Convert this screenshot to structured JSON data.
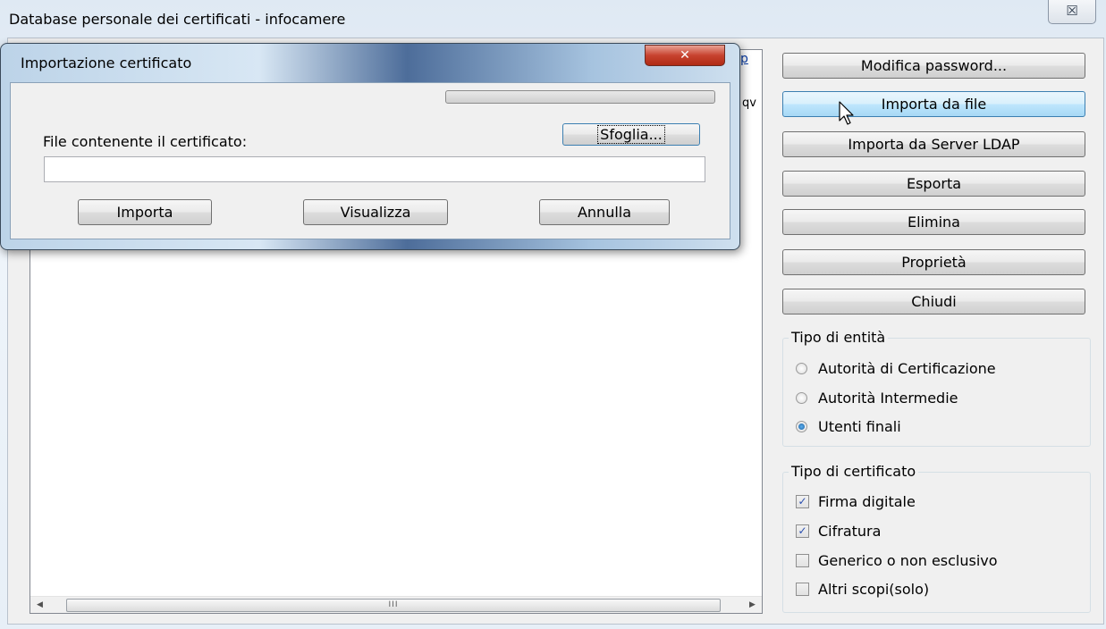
{
  "window": {
    "title": "Database personale dei certificati - infocamere",
    "close_glyph": "☒"
  },
  "dialog": {
    "title": "Importazione certificato",
    "close_glyph": "✕",
    "file_label": "File contenente il certificato:",
    "file_value": "",
    "browse_label": "Sfoglia...",
    "import_label": "Importa",
    "view_label": "Visualizza",
    "cancel_label": "Annulla"
  },
  "background_fragments": {
    "frag1": "p",
    "frag2": "qv"
  },
  "buttons": {
    "modifica_password": "Modifica password...",
    "importa_da_file": "Importa da file",
    "importa_ldap": "Importa da Server LDAP",
    "esporta": "Esporta",
    "elimina": "Elimina",
    "proprieta": "Proprietà",
    "chiudi": "Chiudi"
  },
  "entity_type": {
    "title": "Tipo di entità",
    "options": [
      {
        "label": "Autorità di Certificazione",
        "selected": false
      },
      {
        "label": "Autorità Intermedie",
        "selected": false
      },
      {
        "label": "Utenti finali",
        "selected": true
      }
    ]
  },
  "cert_type": {
    "title": "Tipo di certificato",
    "options": [
      {
        "label": "Firma digitale",
        "checked": true
      },
      {
        "label": "Cifratura",
        "checked": true
      },
      {
        "label": "Generico o non esclusivo",
        "checked": false
      },
      {
        "label": "Altri scopi(solo)",
        "checked": false
      }
    ]
  },
  "scrollbar": {
    "left_arrow": "◀",
    "right_arrow": "▶",
    "thumb_grip": "III"
  },
  "check_glyph": "✓"
}
